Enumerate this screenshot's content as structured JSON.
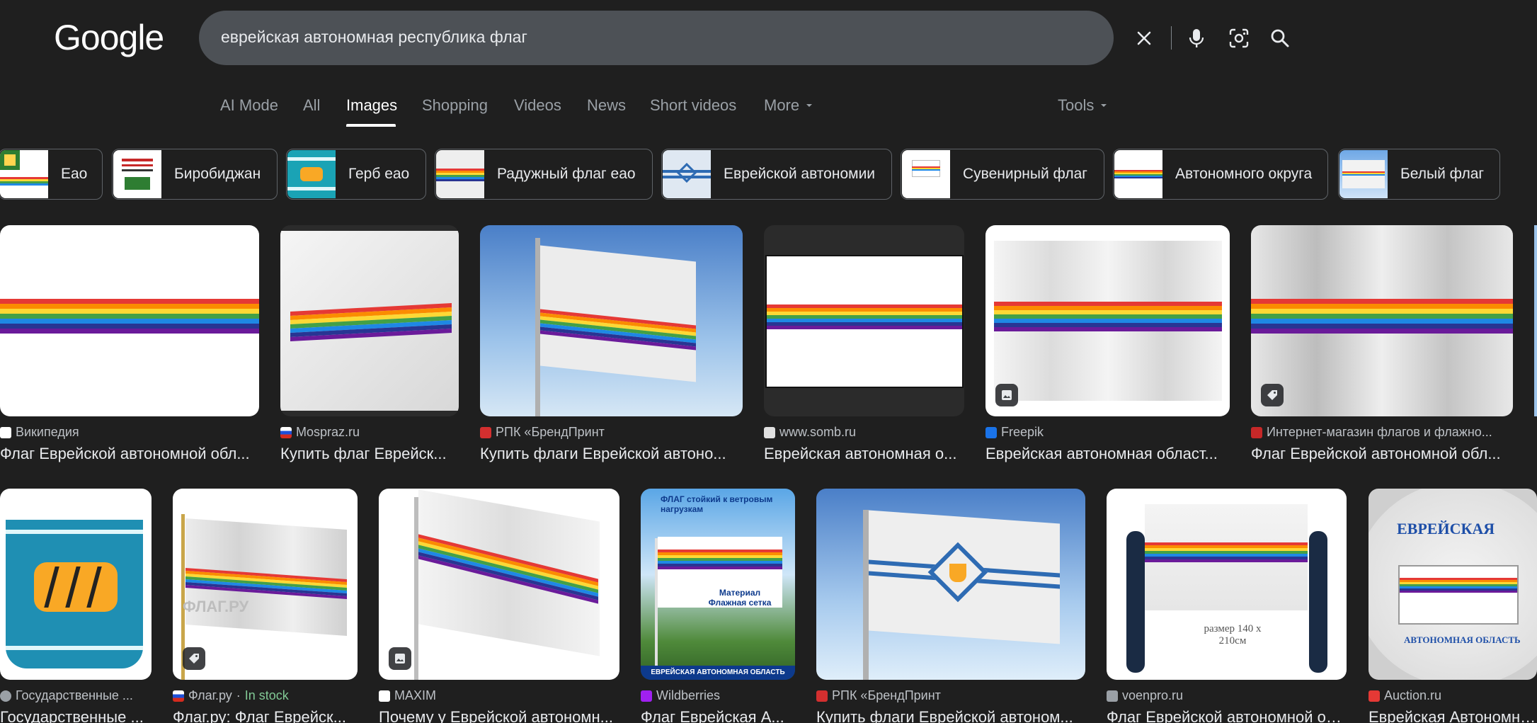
{
  "header": {
    "logo_text": "Google",
    "query": "еврейская автономная республика флаг"
  },
  "tabs": [
    "AI Mode",
    "All",
    "Images",
    "Shopping",
    "Videos",
    "News",
    "Short videos",
    "More",
    "Tools"
  ],
  "active_tab": "Images",
  "chips": [
    "Еао",
    "Биробиджан",
    "Герб еао",
    "Радужный флаг еао",
    "Еврейской автономии",
    "Сувенирный флаг",
    "Автономного округа",
    "Белый флаг"
  ],
  "results_row1": [
    {
      "source": "Википедия",
      "title": "Флаг Еврейской автономной обл..."
    },
    {
      "source": "Mospraz.ru",
      "title": "Купить флаг Еврейск..."
    },
    {
      "source": "РПК «БрендПринт",
      "title": "Купить флаги Еврейской автоно..."
    },
    {
      "source": "www.somb.ru",
      "title": "Еврейская автономная о..."
    },
    {
      "source": "Freepik",
      "title": "Еврейская автономная област..."
    },
    {
      "source": "Интернет-магазин флагов и флажно...",
      "title": "Флаг Еврейской автономной обл..."
    }
  ],
  "results_row2": [
    {
      "source": "Государственные ...",
      "title": "Государственные ..."
    },
    {
      "source": "Флаг.ру",
      "stock": "In stock",
      "title": "Флаг.ру: Флаг Еврейск..."
    },
    {
      "source": "MAXIM",
      "title": "Почему у Еврейской автономн..."
    },
    {
      "source": "Wildberries",
      "title": "Флаг Еврейская А..."
    },
    {
      "source": "РПК «БрендПринт",
      "title": "Купить флаги Еврейской автоном..."
    },
    {
      "source": "voenpro.ru",
      "title": "Флаг Еврейской автономной об..."
    },
    {
      "source": "Auction.ru",
      "title": "Еврейская Автономна..."
    }
  ],
  "image_text": {
    "flagru_watermark": "ФЛАГ.РУ",
    "wb_top": "ФЛАГ стойкий к ветровым нагрузкам",
    "wb_mesh": "Материал Флажная сетка",
    "wb_bottom": "ЕВРЕЙСКАЯ АВТОНОМНАЯ ОБЛАСТЬ",
    "voen_size": "размер 140 x 210см",
    "auction_top": "ЕВРЕЙСКАЯ",
    "auction_bottom": "АВТОНОМНАЯ ОБЛАСТЬ"
  },
  "colors": {
    "background": "#1f1f1f",
    "searchbar": "#4d5156",
    "rainbow": [
      "#e53935",
      "#fb8c00",
      "#fdd835",
      "#43a047",
      "#1e88e5",
      "#1a237e",
      "#6a1b9a"
    ],
    "stock_green": "#81c995"
  },
  "icons": [
    "clear-icon",
    "mic-icon",
    "lens-icon",
    "search-icon",
    "dropdown-icon",
    "image-badge-icon",
    "tag-badge-icon"
  ]
}
